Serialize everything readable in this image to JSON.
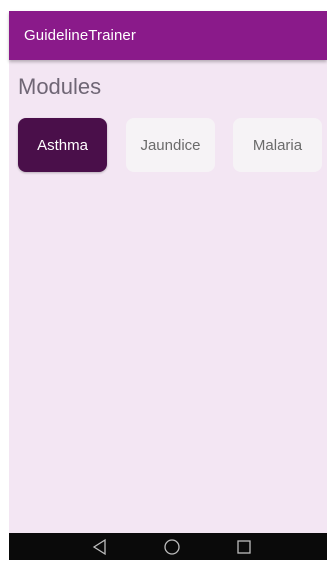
{
  "app": {
    "title": "GuidelineTrainer"
  },
  "main": {
    "section_title": "Modules",
    "modules": [
      {
        "label": "Asthma",
        "selected": true
      },
      {
        "label": "Jaundice",
        "selected": false
      },
      {
        "label": "Malaria",
        "selected": false
      }
    ]
  },
  "colors": {
    "appbar": "#8a1a8a",
    "background": "#f3e6f3",
    "selected_module": "#4a0f4a",
    "unselected_module": "#f6f3f6"
  },
  "navbar": {
    "icons": [
      "back-triangle-icon",
      "home-circle-icon",
      "recent-apps-square-icon"
    ]
  }
}
